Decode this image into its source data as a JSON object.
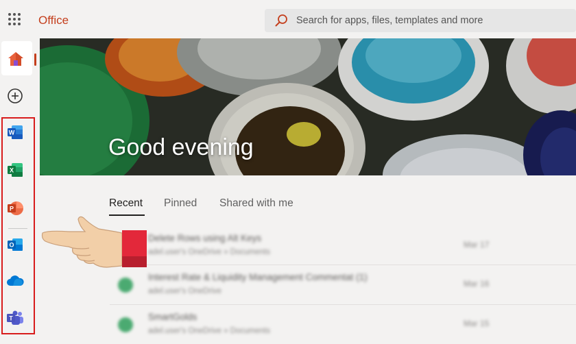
{
  "header": {
    "brand": "Office",
    "search_placeholder": "Search for apps, files, templates and more"
  },
  "rail": {
    "items": [
      {
        "name": "Home",
        "icon": "home-icon"
      },
      {
        "name": "Create",
        "icon": "add-icon"
      },
      {
        "name": "Word",
        "icon": "word-icon",
        "color": "#2b579a"
      },
      {
        "name": "Excel",
        "icon": "excel-icon",
        "color": "#217346"
      },
      {
        "name": "PowerPoint",
        "icon": "powerpoint-icon",
        "color": "#c43e1c"
      },
      {
        "name": "Outlook",
        "icon": "outlook-icon",
        "color": "#0078d4"
      },
      {
        "name": "OneDrive",
        "icon": "onedrive-icon",
        "color": "#0a66c2"
      },
      {
        "name": "Teams",
        "icon": "teams-icon",
        "color": "#5b5fc7"
      }
    ],
    "apps_highlight_color": "#d81b1b"
  },
  "hero": {
    "greeting": "Good evening"
  },
  "tabs": [
    {
      "label": "Recent",
      "active": true
    },
    {
      "label": "Pinned",
      "active": false
    },
    {
      "label": "Shared with me",
      "active": false
    }
  ],
  "files": [
    {
      "name": "Delete Rows using Alt Keys",
      "path": "adel.user's OneDrive » Documents",
      "date": "Mar 17"
    },
    {
      "name": "Interest Rate & Liquidity Management Commentat (1)",
      "path": "adel.user's OneDrive",
      "date": "Mar 16"
    },
    {
      "name": "SmartGolds",
      "path": "adel.user's OneDrive » Documents",
      "date": "Mar 15"
    }
  ],
  "accent_color": "#c43e1c"
}
